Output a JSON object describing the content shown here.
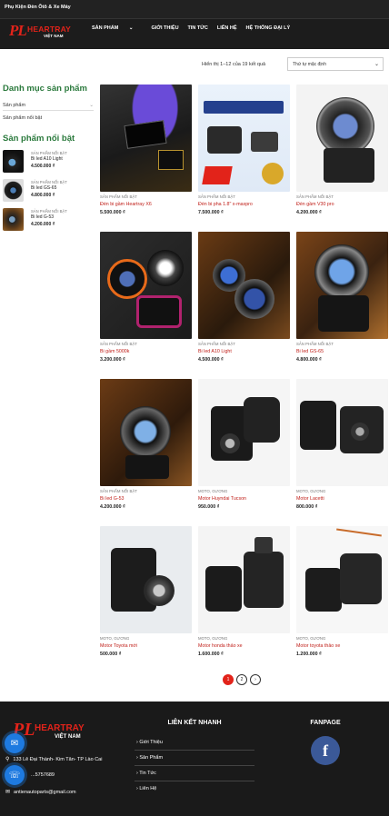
{
  "topbar": {
    "text": "Phụ Kiện Đèn Ôtô & Xe Máy"
  },
  "logo": {
    "mark": "PL",
    "brand": "HEARTRAY",
    "sub": "VIỆT NAM"
  },
  "nav": {
    "items": [
      "SẢN PHẨM",
      "GIỚI THIỆU",
      "TIN TỨC",
      "LIÊN HỆ",
      "HỆ THỐNG ĐẠI LÝ"
    ]
  },
  "sidebar": {
    "cat_title": "Danh mục sản phẩm",
    "cat_select": "Sản phẩm",
    "cat_sub": "Sản phẩm nổi bật",
    "feat_title": "Sản phẩm nổi bật",
    "items": [
      {
        "cat": "SẢN PHẨM NỔI BẬT",
        "name": "Bi led A10 Light",
        "price": "4.500.000 ₫"
      },
      {
        "cat": "SẢN PHẨM NỔI BẬT",
        "name": "Bi led GS-65",
        "price": "4.800.000 ₫"
      },
      {
        "cat": "SẢN PHẨM NỔI BẬT",
        "name": "Bi led G-53",
        "price": "4.200.000 ₫"
      }
    ]
  },
  "toolbar": {
    "result": "Hiển thị 1–12 của 19 kết quả",
    "sort": "Thứ tự mặc định"
  },
  "products": [
    {
      "cat": "SẢN PHẨM NỔI BẬT",
      "name": "Đèn bi gầm Heartray X6",
      "price": "5.500.000 ₫"
    },
    {
      "cat": "SẢN PHẨM NỔI BẬT",
      "name": "Đèn bi pha 1.8\" x-maxpro",
      "price": "7.500.000 ₫"
    },
    {
      "cat": "SẢN PHẨM NỔI BẬT",
      "name": "Đèn gầm V30 pro",
      "price": "4.200.000 ₫"
    },
    {
      "cat": "SẢN PHẨM NỔI BẬT",
      "name": "Bi gầm 5000k",
      "price": "3.200.000 ₫"
    },
    {
      "cat": "SẢN PHẨM NỔI BẬT",
      "name": "Bi led A10 Light",
      "price": "4.500.000 ₫"
    },
    {
      "cat": "SẢN PHẨM NỔI BẬT",
      "name": "Bi led GS-65",
      "price": "4.800.000 ₫"
    },
    {
      "cat": "SẢN PHẨM NỔI BẬT",
      "name": "Bi led G-53",
      "price": "4.200.000 ₫"
    },
    {
      "cat": "MOTO, GƯƠNG",
      "name": "Motor Huyndai Tucson",
      "price": "950.000 ₫"
    },
    {
      "cat": "MOTO, GƯƠNG",
      "name": "Motor Lacetti",
      "price": "800.000 ₫"
    },
    {
      "cat": "MOTO, GƯƠNG",
      "name": "Motor Toyota mới",
      "price": "500.000 ₫"
    },
    {
      "cat": "MOTO, GƯƠNG",
      "name": "Motor honda thảo xe",
      "price": "1.600.000 ₫"
    },
    {
      "cat": "MOTO, GƯƠNG",
      "name": "Motor toyota thảo xe",
      "price": "1.200.000 ₫"
    }
  ],
  "pager": {
    "p1": "1",
    "p2": "2",
    "next": "›"
  },
  "footer": {
    "address": "133 Lê Đại Thành- Kim Tân- TP Lào Cai",
    "phone": "...5757689",
    "email": "antienautoparts@gmail.com",
    "quick_title": "LIÊN KẾT NHANH",
    "quick_items": [
      "Giới Thiệu",
      "Sản Phẩm",
      "Tin Tức",
      "Liên Hệ"
    ],
    "fanpage_title": "FANPAGE",
    "fb_letter": "f"
  },
  "colors": {
    "accent": "#e2231a",
    "green": "#2b7a3d",
    "dark": "#1c1c1c",
    "facebook": "#3b5998",
    "float": "#1e7ae0"
  }
}
